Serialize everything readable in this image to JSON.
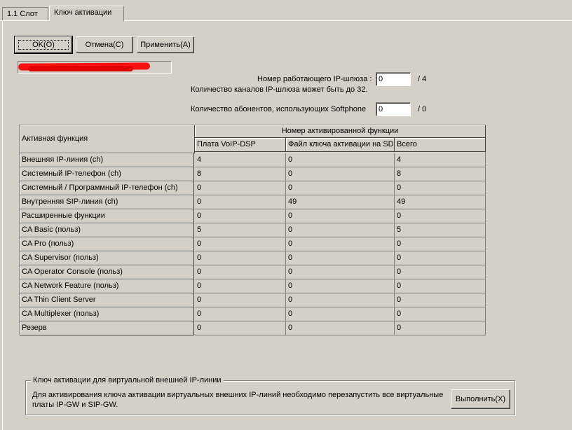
{
  "tabs": [
    {
      "label": "1.1 Слот",
      "active": false
    },
    {
      "label": "Ключ активации",
      "active": true
    }
  ],
  "toolbar": {
    "ok_label": "OK(O)",
    "cancel_label": "Отмена(C)",
    "apply_label": "Применить(A)"
  },
  "gateway": {
    "count_label": "Номер работающего IP-шлюза :",
    "count_value": "0",
    "count_max": "/ 4",
    "channels_note": "Количество каналов IP-шлюза может быть до 32."
  },
  "softphone": {
    "label": "Количество абонентов, использующих Softphone",
    "value": "0",
    "max": "/ 0"
  },
  "table": {
    "row_header_title": "Активная функция",
    "group_header": "Номер активированной функции",
    "columns": [
      "Плата VoIP-DSP",
      "Файл ключа активации на SD",
      "Всего"
    ],
    "rows": [
      {
        "name": "Внешняя IP-линия (ch)",
        "values": [
          "4",
          "0",
          "4"
        ]
      },
      {
        "name": "Системный IP-телефон (ch)",
        "values": [
          "8",
          "0",
          "8"
        ]
      },
      {
        "name": "Системный / Программный IP-телефон (ch)",
        "values": [
          "0",
          "0",
          "0"
        ]
      },
      {
        "name": "Внутренняя SIP-линия (ch)",
        "values": [
          "0",
          "49",
          "49"
        ]
      },
      {
        "name": "Расширенные функции",
        "values": [
          "0",
          "0",
          "0"
        ]
      },
      {
        "name": "CA Basic (польз)",
        "values": [
          "5",
          "0",
          "5"
        ]
      },
      {
        "name": "CA Pro (польз)",
        "values": [
          "0",
          "0",
          "0"
        ]
      },
      {
        "name": "CA Supervisor (польз)",
        "values": [
          "0",
          "0",
          "0"
        ]
      },
      {
        "name": "CA Operator Console (польз)",
        "values": [
          "0",
          "0",
          "0"
        ]
      },
      {
        "name": "CA Network Feature (польз)",
        "values": [
          "0",
          "0",
          "0"
        ]
      },
      {
        "name": "CA Thin Client Server",
        "values": [
          "0",
          "0",
          "0"
        ]
      },
      {
        "name": "CA Multiplexer (польз)",
        "values": [
          "0",
          "0",
          "0"
        ]
      },
      {
        "name": "Резерв",
        "values": [
          "0",
          "0",
          "0"
        ]
      }
    ]
  },
  "virtual_key": {
    "title": "Ключ активации для виртуальной внешней IP-линии",
    "message_line1": "Для активирования ключа активации виртуальных внешних IP-линий необходимо перезапустить все виртуальные",
    "message_line2": "платы IP-GW и SIP-GW.",
    "run_label": "Выполнить(X)"
  },
  "colors": {
    "window_bg": "#d4d0c8",
    "redaction": "#ff1010"
  }
}
